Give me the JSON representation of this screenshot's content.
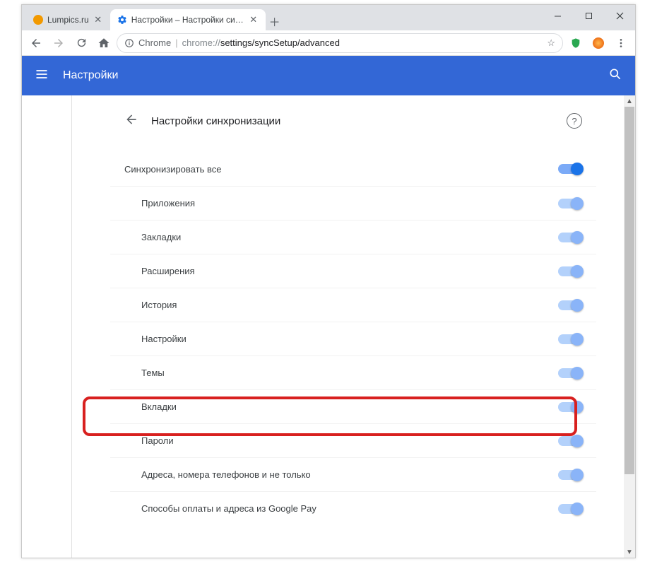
{
  "window": {
    "tabs": [
      {
        "title": "Lumpics.ru",
        "favicon_color": "#f29900",
        "active": false
      },
      {
        "title": "Настройки – Настройки синхро",
        "favicon_is_gear": true,
        "active": true
      }
    ],
    "controls": {
      "min": "—",
      "max": "☐",
      "close": "✕"
    }
  },
  "toolbar": {
    "secure_label": "Chrome",
    "url_prefix": "chrome://",
    "url_path": "settings/syncSetup/advanced"
  },
  "bluebar": {
    "title": "Настройки"
  },
  "section": {
    "heading": "Настройки синхронизации"
  },
  "sync": {
    "master_label": "Синхронизировать все",
    "items": [
      {
        "label": "Приложения"
      },
      {
        "label": "Закладки"
      },
      {
        "label": "Расширения"
      },
      {
        "label": "История"
      },
      {
        "label": "Настройки"
      },
      {
        "label": "Темы"
      },
      {
        "label": "Вкладки"
      },
      {
        "label": "Пароли",
        "highlighted": true
      },
      {
        "label": "Адреса, номера телефонов и не только"
      },
      {
        "label": "Способы оплаты и адреса из Google Pay"
      }
    ]
  }
}
